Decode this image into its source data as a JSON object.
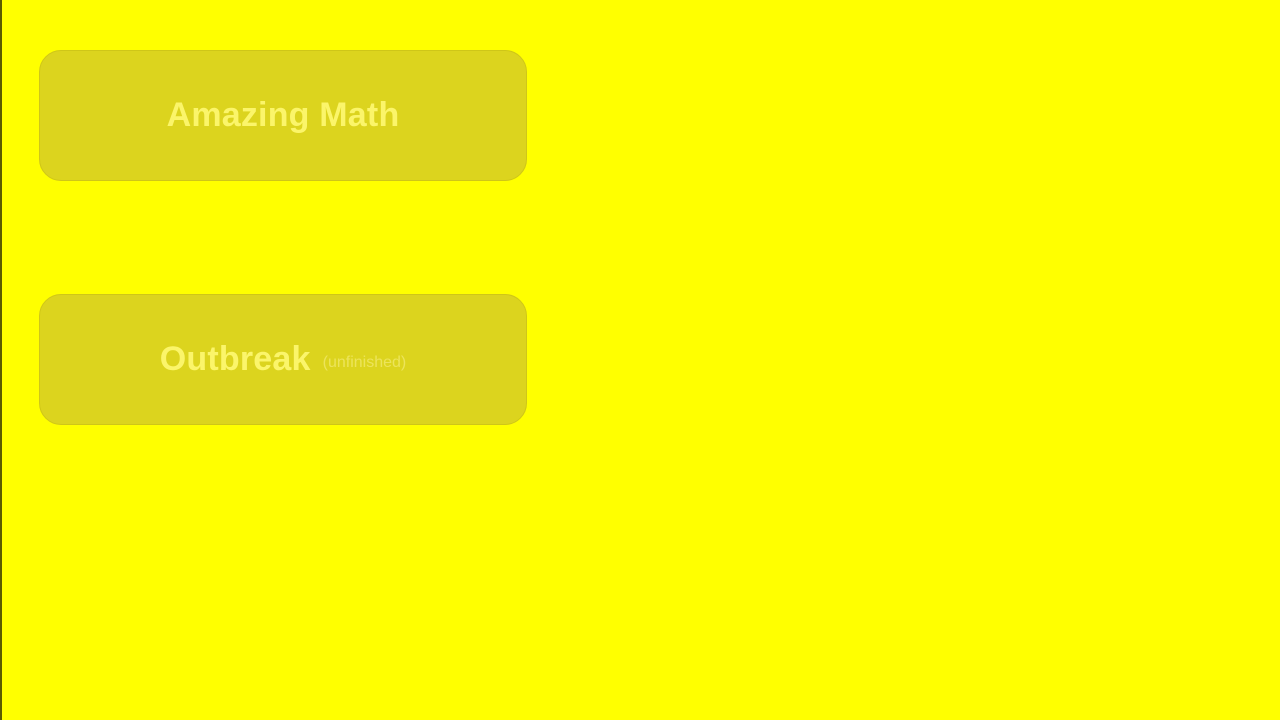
{
  "theme": {
    "background": "#ffff00",
    "button_fill": "#dcd41e",
    "button_text": "#fbf56a"
  },
  "menu": {
    "items": [
      {
        "label": "Amazing Math",
        "note": ""
      },
      {
        "label": "Outbreak",
        "note": "(unfinished)"
      }
    ]
  }
}
